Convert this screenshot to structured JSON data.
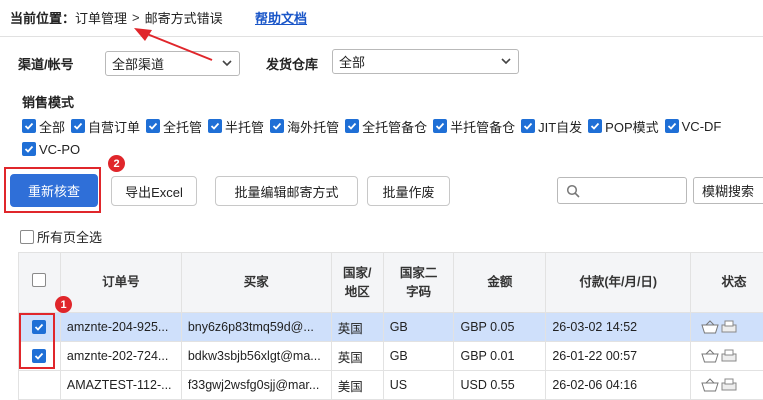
{
  "breadcrumb": {
    "label": "当前位置：",
    "items": [
      "订单管理",
      "邮寄方式错误"
    ],
    "separator": ">"
  },
  "help_link": "帮助文档",
  "filters": {
    "channel_label": "渠道/帐号",
    "channel_value": "全部渠道",
    "warehouse_label": "发货仓库",
    "warehouse_value": "全部",
    "sales_mode_label": "销售模式",
    "modes": [
      "全部",
      "自营订单",
      "全托管",
      "半托管",
      "海外托管",
      "全托管备仓",
      "半托管备仓",
      "JIT自发",
      "POP模式",
      "VC-DF",
      "VC-PO"
    ]
  },
  "toolbar": {
    "recheck": "重新核查",
    "export": "导出Excel",
    "batch_edit": "批量编辑邮寄方式",
    "batch_void": "批量作废",
    "search_placeholder": "",
    "fuzzy_search": "模糊搜索"
  },
  "select_all_pages": "所有页全选",
  "annotations": {
    "badge_1": "1",
    "badge_2": "2"
  },
  "table": {
    "headers": [
      "订单号",
      "买家",
      "国家/地区",
      "国家二字码",
      "金额",
      "付款(年/月/日)",
      "状态"
    ],
    "header_lines": {
      "country": [
        "国家/",
        "地区"
      ],
      "code": [
        "国家二",
        "字码"
      ]
    },
    "rows": [
      {
        "checked": true,
        "order": "amznte-204-925...",
        "buyer": "bny6z6p83tmq59d@...",
        "country": "英国",
        "code": "GB",
        "amount": "GBP 0.05",
        "paid": "26-03-02 14:52"
      },
      {
        "checked": true,
        "order": "amznte-202-724...",
        "buyer": "bdkw3sbjb56xlgt@ma...",
        "country": "英国",
        "code": "GB",
        "amount": "GBP 0.01",
        "paid": "26-01-22 00:57"
      },
      {
        "checked": false,
        "order": "AMAZTEST-112-...",
        "buyer": "f33gwj2wsfg0sjj@mar...",
        "country": "美国",
        "code": "US",
        "amount": "USD 0.55",
        "paid": "26-02-06 04:16"
      }
    ]
  },
  "colors": {
    "accent": "#2f6fd8",
    "highlight": "#e0262b",
    "selected_row": "#cfe0fb"
  }
}
